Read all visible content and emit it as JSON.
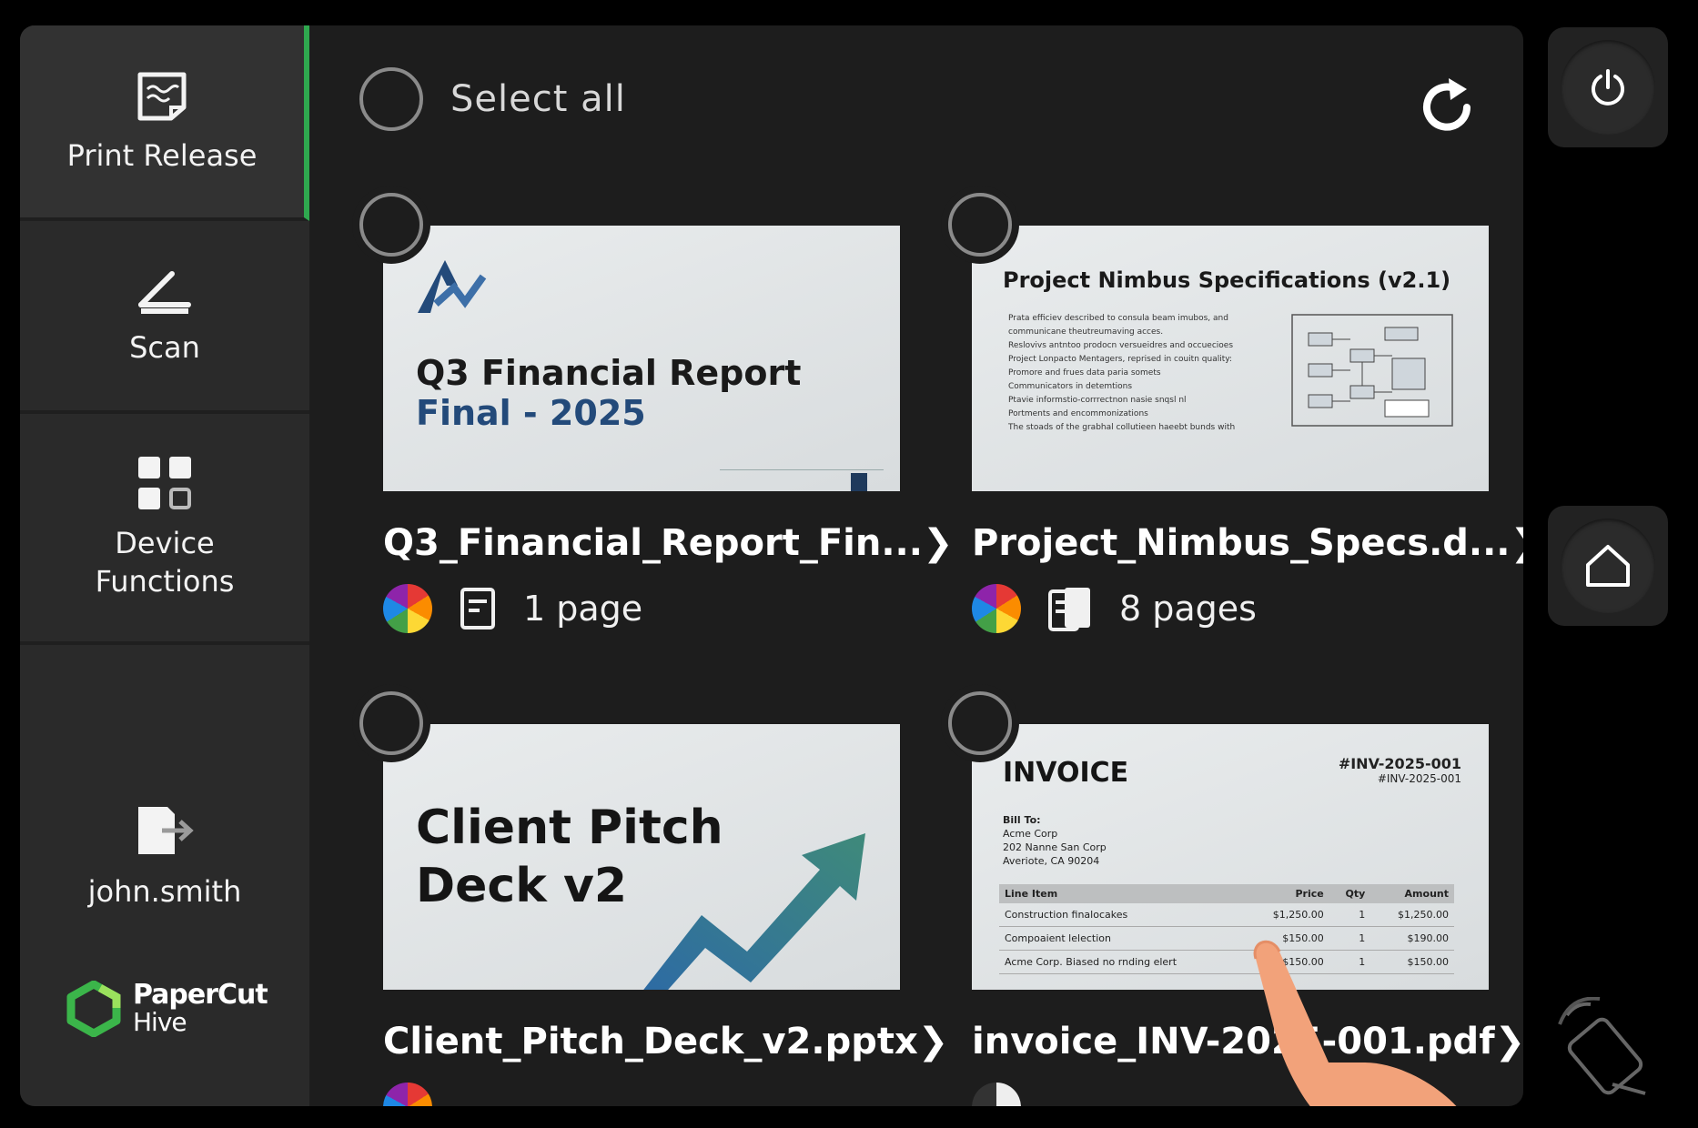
{
  "sidebar": {
    "items": [
      {
        "label": "Print Release",
        "icon": "print-release-icon"
      },
      {
        "label": "Scan",
        "icon": "scan-icon"
      },
      {
        "label": "Device\nFunctions",
        "icon": "device-functions-icon"
      }
    ],
    "user": {
      "name": "john.smith",
      "icon": "logout-icon"
    },
    "brand": {
      "name": "PaperCut",
      "sub": "Hive"
    }
  },
  "header": {
    "select_all_label": "Select all"
  },
  "jobs": [
    {
      "filename": "Q3_Financial_Report_Fin...",
      "pages": "1 page",
      "thumb_line1": "Q3 Financial Report",
      "thumb_line2": "Final - 2025"
    },
    {
      "filename": "Project_Nimbus_Specs.d...",
      "pages": "8 pages",
      "thumb_title": "Project Nimbus Specifications (v2.1)",
      "thumb_lines": [
        "Prata efficiev described to consula beam imubos, and",
        "communicane theutreumaving acces.",
        "Reslovivs antntoo prodocn versueidres and occuecioes",
        "Project Lonpacto Mentagers, reprised in couitn quality:",
        "Promore and frues data paria somets",
        "Communicators in detemtions",
        "Ptavie informstio-corrrectnon nasie snqsl nl",
        "Portments and encommonizations",
        "The stoads of the grabhal collutieen haeebt bunds with"
      ]
    },
    {
      "filename": "Client_Pitch_Deck_v2.pptx",
      "pages": "",
      "thumb_line1": "Client Pitch",
      "thumb_line2": "Deck v2"
    },
    {
      "filename": "invoice_INV-2025-001.pdf",
      "pages": "",
      "thumb_title": "INVOICE",
      "thumb_number": "#INV-2025-001",
      "thumb_number_sub": "#INV-2025-001",
      "bill_to": [
        "Bill To:",
        "Acme Corp",
        "202 Nanne San Corp",
        "Averiote, CA 90204"
      ],
      "table_header": [
        "Line Item",
        "Price",
        "Qty",
        "Amount"
      ],
      "table_rows": [
        [
          "Construction finalocakes",
          "$1,250.00",
          "1",
          "$1,250.00"
        ],
        [
          "Compoaient lelection",
          "$150.00",
          "1",
          "$190.00"
        ],
        [
          "Acme Corp. Biased no rnding elert",
          "$150.00",
          "1",
          "$150.00"
        ]
      ]
    }
  ],
  "colors": {
    "background": "#1d1d1d",
    "sidebar": "#2a2a2a",
    "active_indicator": "#2fa84f",
    "brand_green": "#3bb54a"
  }
}
